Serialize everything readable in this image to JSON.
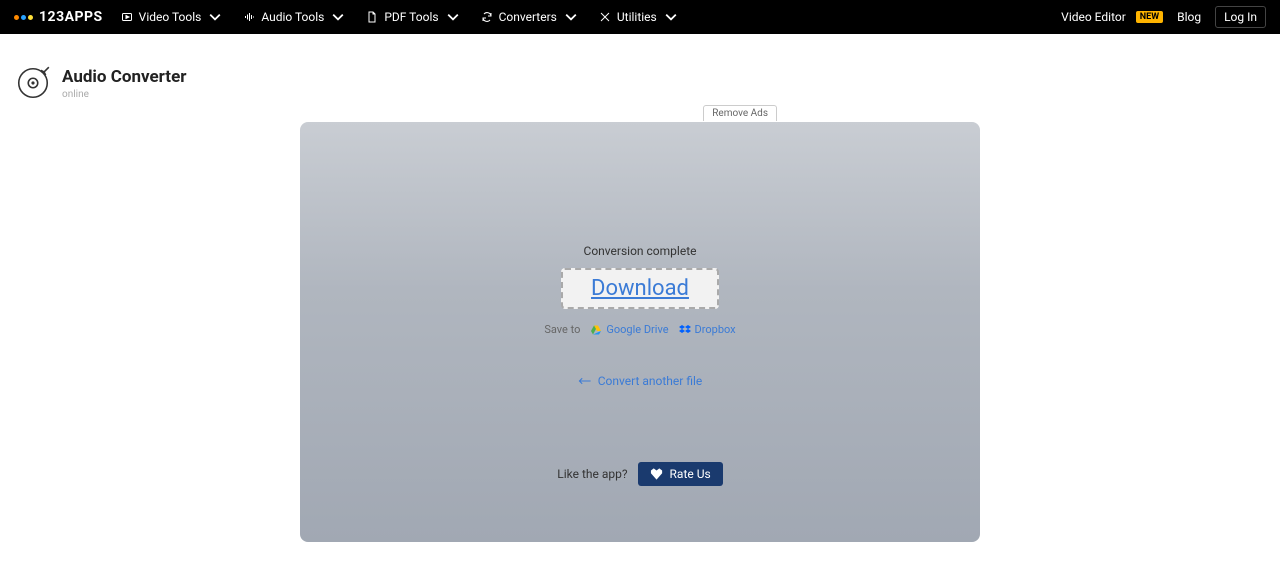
{
  "brand": {
    "name": "123APPS"
  },
  "nav": {
    "items": [
      {
        "label": "Video Tools"
      },
      {
        "label": "Audio Tools"
      },
      {
        "label": "PDF Tools"
      },
      {
        "label": "Converters"
      },
      {
        "label": "Utilities"
      }
    ],
    "right": {
      "video_editor": "Video Editor",
      "new_badge": "NEW",
      "blog": "Blog",
      "login": "Log In"
    }
  },
  "app": {
    "title": "Audio Converter",
    "subtitle": "online"
  },
  "card": {
    "remove_ads": "Remove Ads",
    "status": "Conversion complete",
    "download": "Download",
    "save_to": "Save to",
    "google_drive": "Google Drive",
    "dropbox": "Dropbox",
    "convert_another": "Convert another file",
    "like_app": "Like the app?",
    "rate_us": "Rate Us"
  }
}
